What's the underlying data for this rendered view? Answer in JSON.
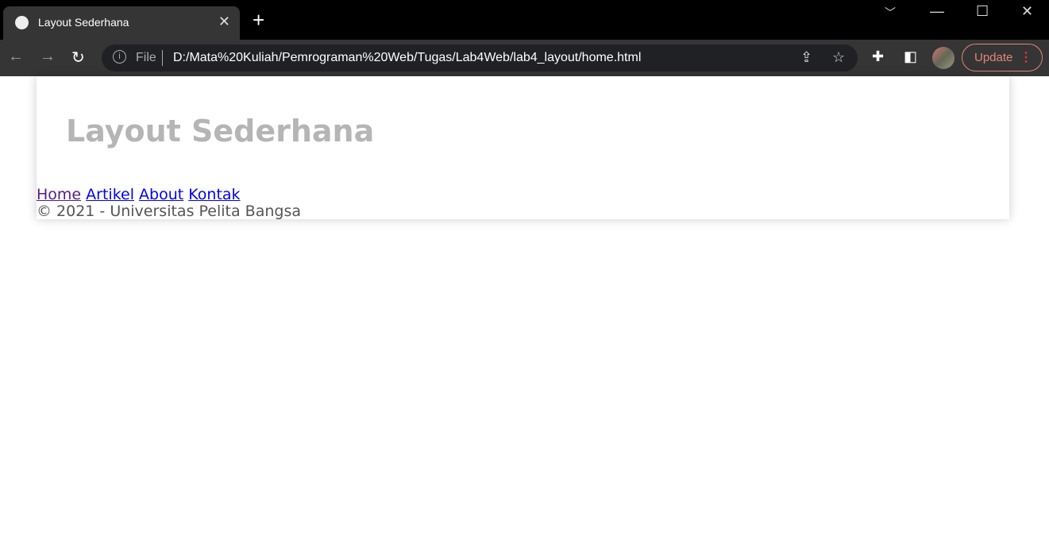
{
  "browser": {
    "tab_title": "Layout Sederhana",
    "omnibox_scheme": "File",
    "url": "D:/Mata%20Kuliah/Pemrograman%20Web/Tugas/Lab4Web/lab4_layout/home.html",
    "update_label": "Update"
  },
  "page": {
    "heading": "Layout Sederhana",
    "nav": [
      "Home",
      "Artikel",
      "About",
      "Kontak"
    ],
    "footer": "© 2021 - Universitas Pelita Bangsa"
  }
}
